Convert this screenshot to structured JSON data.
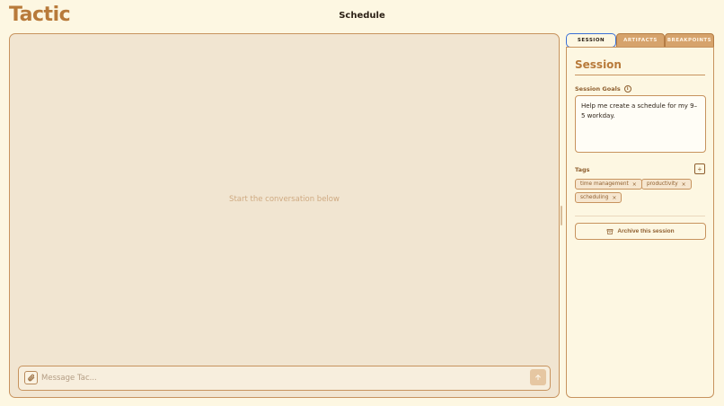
{
  "app": {
    "title": "Tactic"
  },
  "page": {
    "title": "Schedule"
  },
  "chat": {
    "empty_hint": "Start the conversation below",
    "composer": {
      "placeholder": "Message Tac...",
      "value": ""
    },
    "icons": {
      "attach": "paperclip-icon",
      "send": "arrow-up-icon"
    }
  },
  "tabs": [
    {
      "label": "SESSION",
      "active": true
    },
    {
      "label": "ARTIFACTS",
      "active": false
    },
    {
      "label": "BREAKPOINTS",
      "active": false
    }
  ],
  "session": {
    "heading": "Session",
    "goals_label": "Session Goals",
    "goals_text": "Help me create a schedule for my 9–5 workday.",
    "tags_label": "Tags",
    "add_tag_symbol": "+",
    "tags": [
      {
        "label": "time management",
        "remove": "×"
      },
      {
        "label": "productivity",
        "remove": "×"
      },
      {
        "label": "scheduling",
        "remove": "×"
      }
    ],
    "archive_label": "Archive this session"
  },
  "colors": {
    "accent": "#b87a3a",
    "background": "#fdf7e2",
    "chat_background": "#f1e5d1",
    "border": "#c7935e",
    "active_tab_outline": "#3b6fd6"
  }
}
